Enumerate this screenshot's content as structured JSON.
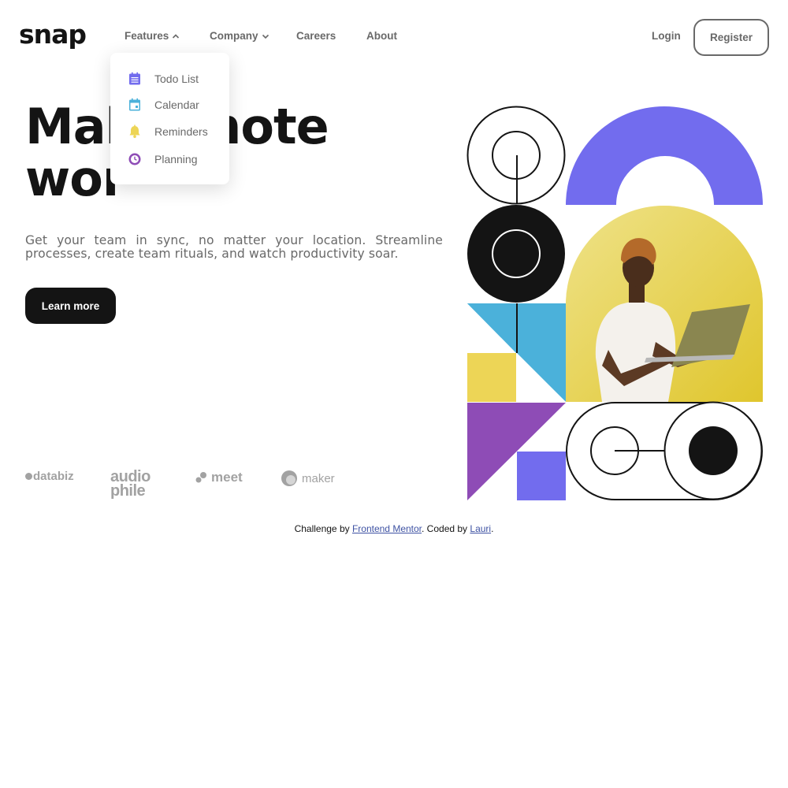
{
  "header": {
    "logo": "snap",
    "nav": [
      {
        "label": "Features",
        "has_caret": true,
        "caret": "chevron-up-icon"
      },
      {
        "label": "Company",
        "has_caret": true,
        "caret": "chevron-down-icon"
      },
      {
        "label": "Careers",
        "has_caret": false
      },
      {
        "label": "About",
        "has_caret": false
      }
    ],
    "login_label": "Login",
    "register_label": "Register"
  },
  "features_menu": {
    "items": [
      {
        "label": "Todo List",
        "icon": "todo-icon",
        "color": "#726CEE"
      },
      {
        "label": "Calendar",
        "icon": "calendar-icon",
        "color": "#4BB1DA"
      },
      {
        "label": "Reminders",
        "icon": "bell-icon",
        "color": "#EDD556"
      },
      {
        "label": "Planning",
        "icon": "clock-icon",
        "color": "#8E4CB6"
      }
    ]
  },
  "hero": {
    "headline_line1_left": "Mal",
    "headline_line1_right": "mote",
    "headline_line2": "wor",
    "tagline": "Get your team in sync, no matter your location. Streamline processes, create team rituals, and watch productivity soar.",
    "cta_label": "Learn more"
  },
  "clients": [
    {
      "name": "databiz",
      "icon": "databiz-logo"
    },
    {
      "name": "audio phile",
      "icon": "audiophile-logo"
    },
    {
      "name": "meet",
      "icon": "meet-logo"
    },
    {
      "name": "maker",
      "icon": "maker-logo"
    }
  ],
  "footer": {
    "prefix": "Challenge by ",
    "link1": "Frontend Mentor",
    "middle": ". Coded by ",
    "link2": "Lauri",
    "suffix": "."
  },
  "colors": {
    "ink": "#141414",
    "gray": "#696969",
    "purple": "#726CEE",
    "blue": "#4BB1DA",
    "yellow": "#EDD556",
    "violet": "#8E4CB6",
    "link": "#3E52A3"
  }
}
